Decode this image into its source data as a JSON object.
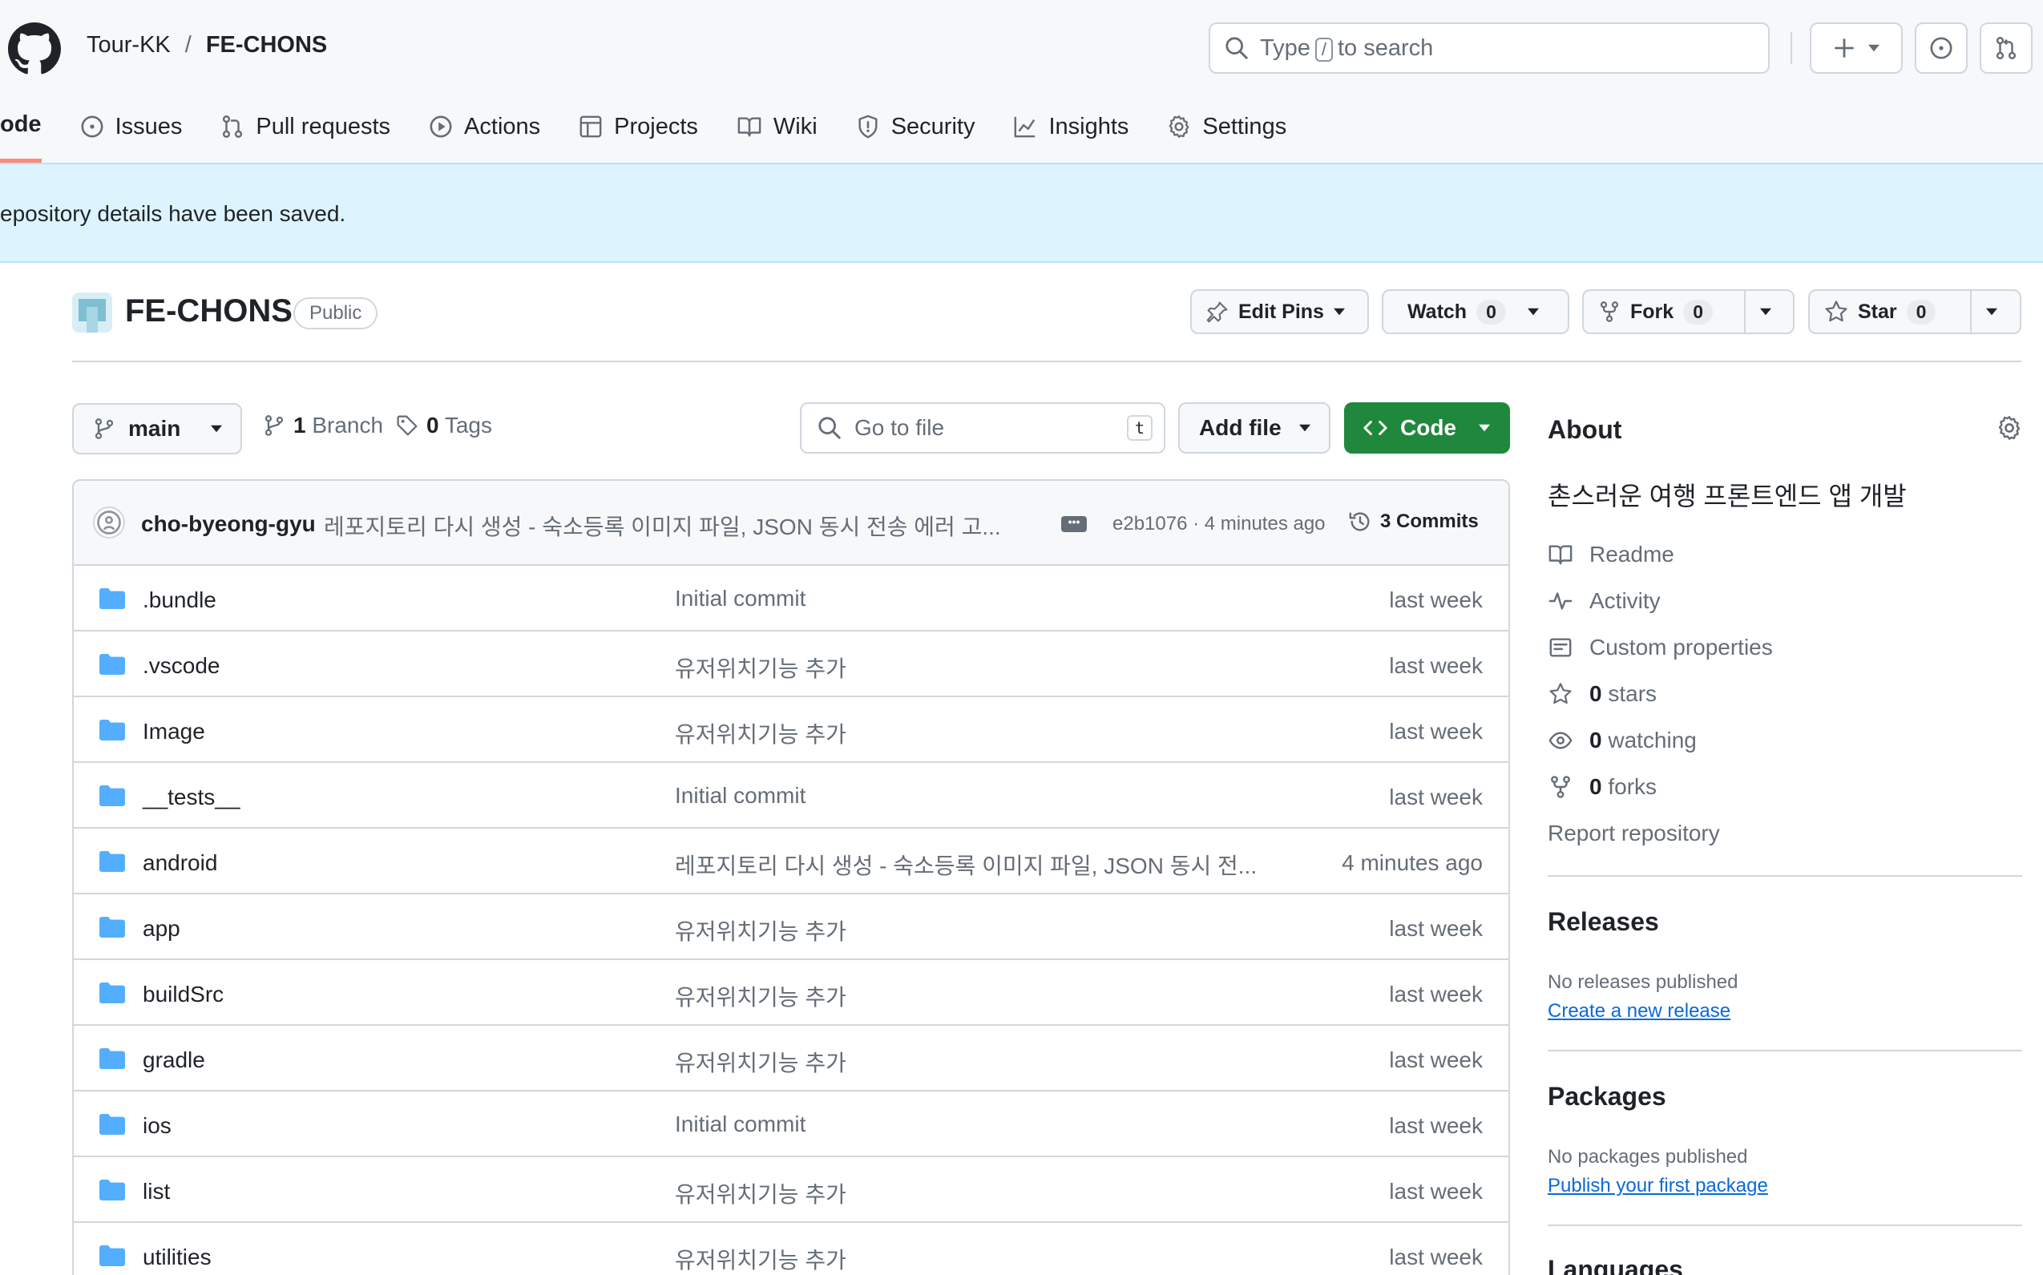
{
  "header": {
    "owner": "Tour-KK",
    "separator": "/",
    "repo": "FE-CHONS",
    "search": {
      "prefix": "Type",
      "key": "/",
      "suffix": "to search"
    }
  },
  "tabs": [
    {
      "label": "ode",
      "icon": "code-icon",
      "active": true
    },
    {
      "label": "Issues",
      "icon": "issue-icon"
    },
    {
      "label": "Pull requests",
      "icon": "pull-request-icon"
    },
    {
      "label": "Actions",
      "icon": "play-icon"
    },
    {
      "label": "Projects",
      "icon": "table-icon"
    },
    {
      "label": "Wiki",
      "icon": "book-icon"
    },
    {
      "label": "Security",
      "icon": "shield-icon"
    },
    {
      "label": "Insights",
      "icon": "graph-icon"
    },
    {
      "label": "Settings",
      "icon": "gear-icon"
    }
  ],
  "flash": {
    "message": "epository details have been saved."
  },
  "repo_header": {
    "name": "FE-CHONS",
    "visibility": "Public",
    "edit_pins": "Edit Pins",
    "watch": "Watch",
    "watch_count": "0",
    "fork": "Fork",
    "fork_count": "0",
    "star": "Star",
    "star_count": "0"
  },
  "filenav": {
    "branch": "main",
    "branches_count": "1",
    "branches_label": "Branch",
    "tags_count": "0",
    "tags_label": "Tags",
    "goto_placeholder": "Go to file",
    "goto_key": "t",
    "add_file": "Add file",
    "code": "Code"
  },
  "latest_commit": {
    "author": "cho-byeong-gyu",
    "message": "레포지토리 다시 생성 - 숙소등록 이미지 파일, JSON 동시 전송 에러 고...",
    "sha_time": "e2b1076 · 4 minutes ago",
    "commits_count": "3",
    "commits_label": "Commits"
  },
  "files": [
    {
      "name": ".bundle",
      "message": "Initial commit",
      "date": "last week"
    },
    {
      "name": ".vscode",
      "message": "유저위치기능 추가",
      "date": "last week"
    },
    {
      "name": "Image",
      "message": "유저위치기능 추가",
      "date": "last week"
    },
    {
      "name": "__tests__",
      "message": "Initial commit",
      "date": "last week"
    },
    {
      "name": "android",
      "message": "레포지토리 다시 생성 - 숙소등록 이미지 파일, JSON 동시 전...",
      "date": "4 minutes ago"
    },
    {
      "name": "app",
      "message": "유저위치기능 추가",
      "date": "last week"
    },
    {
      "name": "buildSrc",
      "message": "유저위치기능 추가",
      "date": "last week"
    },
    {
      "name": "gradle",
      "message": "유저위치기능 추가",
      "date": "last week"
    },
    {
      "name": "ios",
      "message": "Initial commit",
      "date": "last week"
    },
    {
      "name": "list",
      "message": "유저위치기능 추가",
      "date": "last week"
    },
    {
      "name": "utilities",
      "message": "유저위치기능 추가",
      "date": "last week"
    }
  ],
  "about": {
    "title": "About",
    "description": "촌스러운 여행 프론트엔드 앱 개발",
    "readme": "Readme",
    "activity": "Activity",
    "custom_properties": "Custom properties",
    "stars_count": "0",
    "stars_label": "stars",
    "watching_count": "0",
    "watching_label": "watching",
    "forks_count": "0",
    "forks_label": "forks",
    "report": "Report repository"
  },
  "releases": {
    "title": "Releases",
    "empty": "No releases published",
    "create": "Create a new release"
  },
  "packages": {
    "title": "Packages",
    "empty": "No packages published",
    "publish": "Publish your first package"
  },
  "languages": {
    "title": "Languages"
  },
  "colors": {
    "accent_green": "#1f883d",
    "link_blue": "#0969da",
    "folder_blue": "#54aeff",
    "flash_bg": "#ddf4ff",
    "tab_underline": "#fd8c73"
  }
}
